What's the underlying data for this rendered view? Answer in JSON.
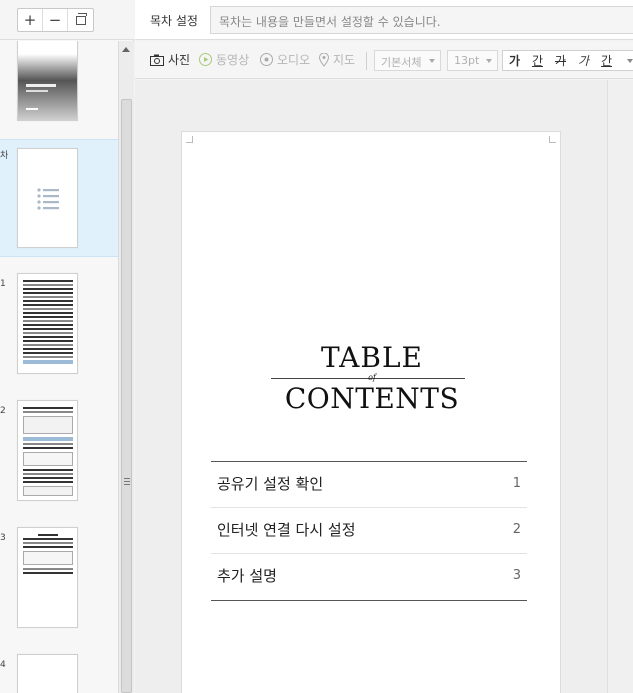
{
  "zoom": {
    "in_label": "+",
    "out_label": "−"
  },
  "sidebar": {
    "pages": [
      {
        "num": ""
      },
      {
        "num": "차"
      },
      {
        "num": "1"
      },
      {
        "num": "2"
      },
      {
        "num": "3"
      },
      {
        "num": "4"
      }
    ]
  },
  "topbar": {
    "toc_label": "목차 설정",
    "toc_placeholder": "목차는 내용을 만들면서 설정할 수 있습니다."
  },
  "toolbar": {
    "photo": "사진",
    "video": "동영상",
    "audio": "오디오",
    "map": "지도",
    "font": "기본서체",
    "size": "13pt",
    "bold": "가",
    "underline": "간",
    "strike": "가",
    "italic": "가",
    "color": "간"
  },
  "page": {
    "title_top": "TABLE",
    "title_of": "of",
    "title_bottom": "CONTENTS",
    "toc": [
      {
        "title": "공유기 설정 확인",
        "page": "1"
      },
      {
        "title": "인터넷 연결 다시 설정",
        "page": "2"
      },
      {
        "title": "추가 설명",
        "page": "3"
      }
    ]
  }
}
